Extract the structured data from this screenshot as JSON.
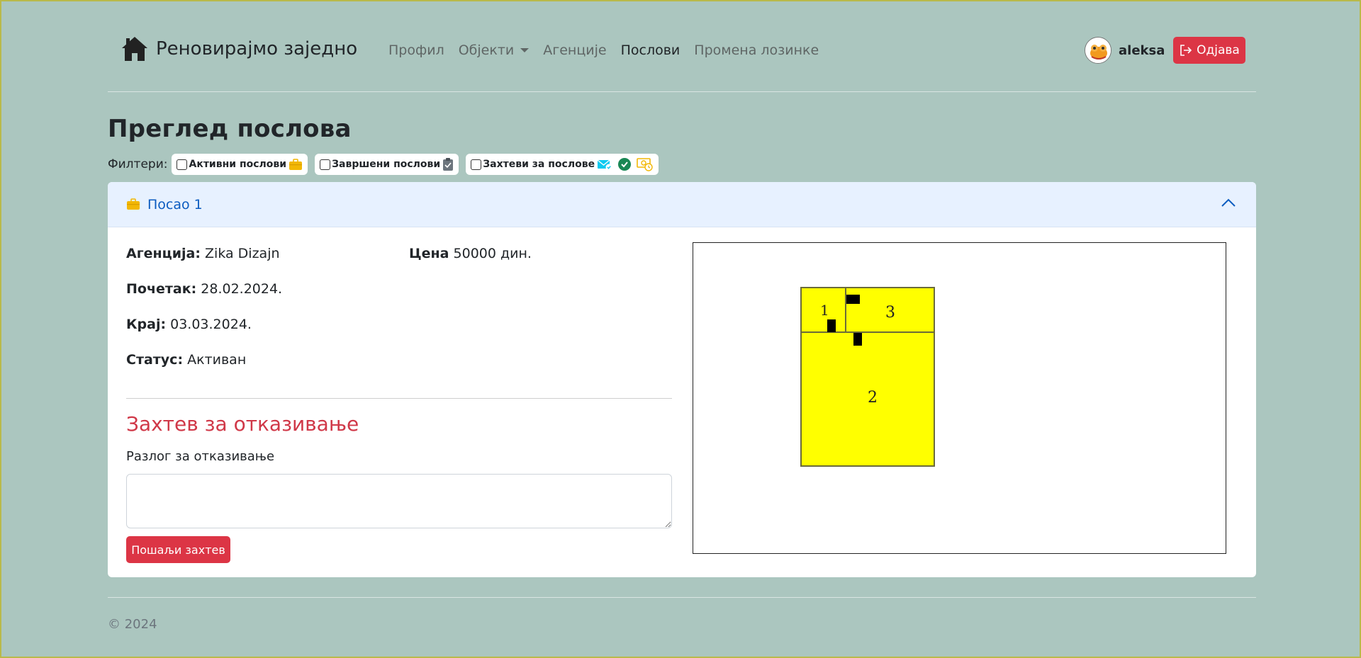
{
  "navbar": {
    "brand": "Реновирајмо заједно",
    "links": [
      "Профил",
      "Објекти",
      "Агенције",
      "Послови",
      "Промена лозинке"
    ],
    "active_link": "Послови",
    "username": "aleksa",
    "logout_label": "Одјава"
  },
  "page": {
    "title": "Преглед послова",
    "filters_label": "Филтери:",
    "filters": [
      {
        "label": "Активни послови",
        "checked": false,
        "icon": "briefcase-icon",
        "color": "#f2b705"
      },
      {
        "label": "Завршени послови",
        "checked": false,
        "icon": "clipboard-check-icon",
        "color": "#6c757d"
      },
      {
        "label": "Захтеви за послове",
        "checked": false,
        "icon": "envelope-check-icon",
        "color": "#0dcaf0"
      }
    ]
  },
  "job": {
    "title": "Посао 1",
    "expanded": true,
    "agency_label": "Агенција:",
    "agency": "Zika Dizajn",
    "price_label": "Цена",
    "price": "50000 дин.",
    "start_label": "Почетак:",
    "start": "28.02.2024.",
    "end_label": "Крај:",
    "end": "03.03.2024.",
    "status_label": "Статус:",
    "status": "Активан",
    "cancel_title": "Захтев за отказивање",
    "reason_label": "Разлог за отказивање",
    "reason_value": "",
    "send_label": "Пошаљи захтев",
    "floorplan": {
      "room_labels": [
        "1",
        "2",
        "3"
      ],
      "room_color": "#ffff00"
    }
  },
  "footer": {
    "copyright": "© 2024"
  },
  "colors": {
    "background": "#abc6bf",
    "danger": "#dc3545",
    "accordion_header": "#e7f1ff",
    "accordion_title": "#0c5cc0"
  }
}
